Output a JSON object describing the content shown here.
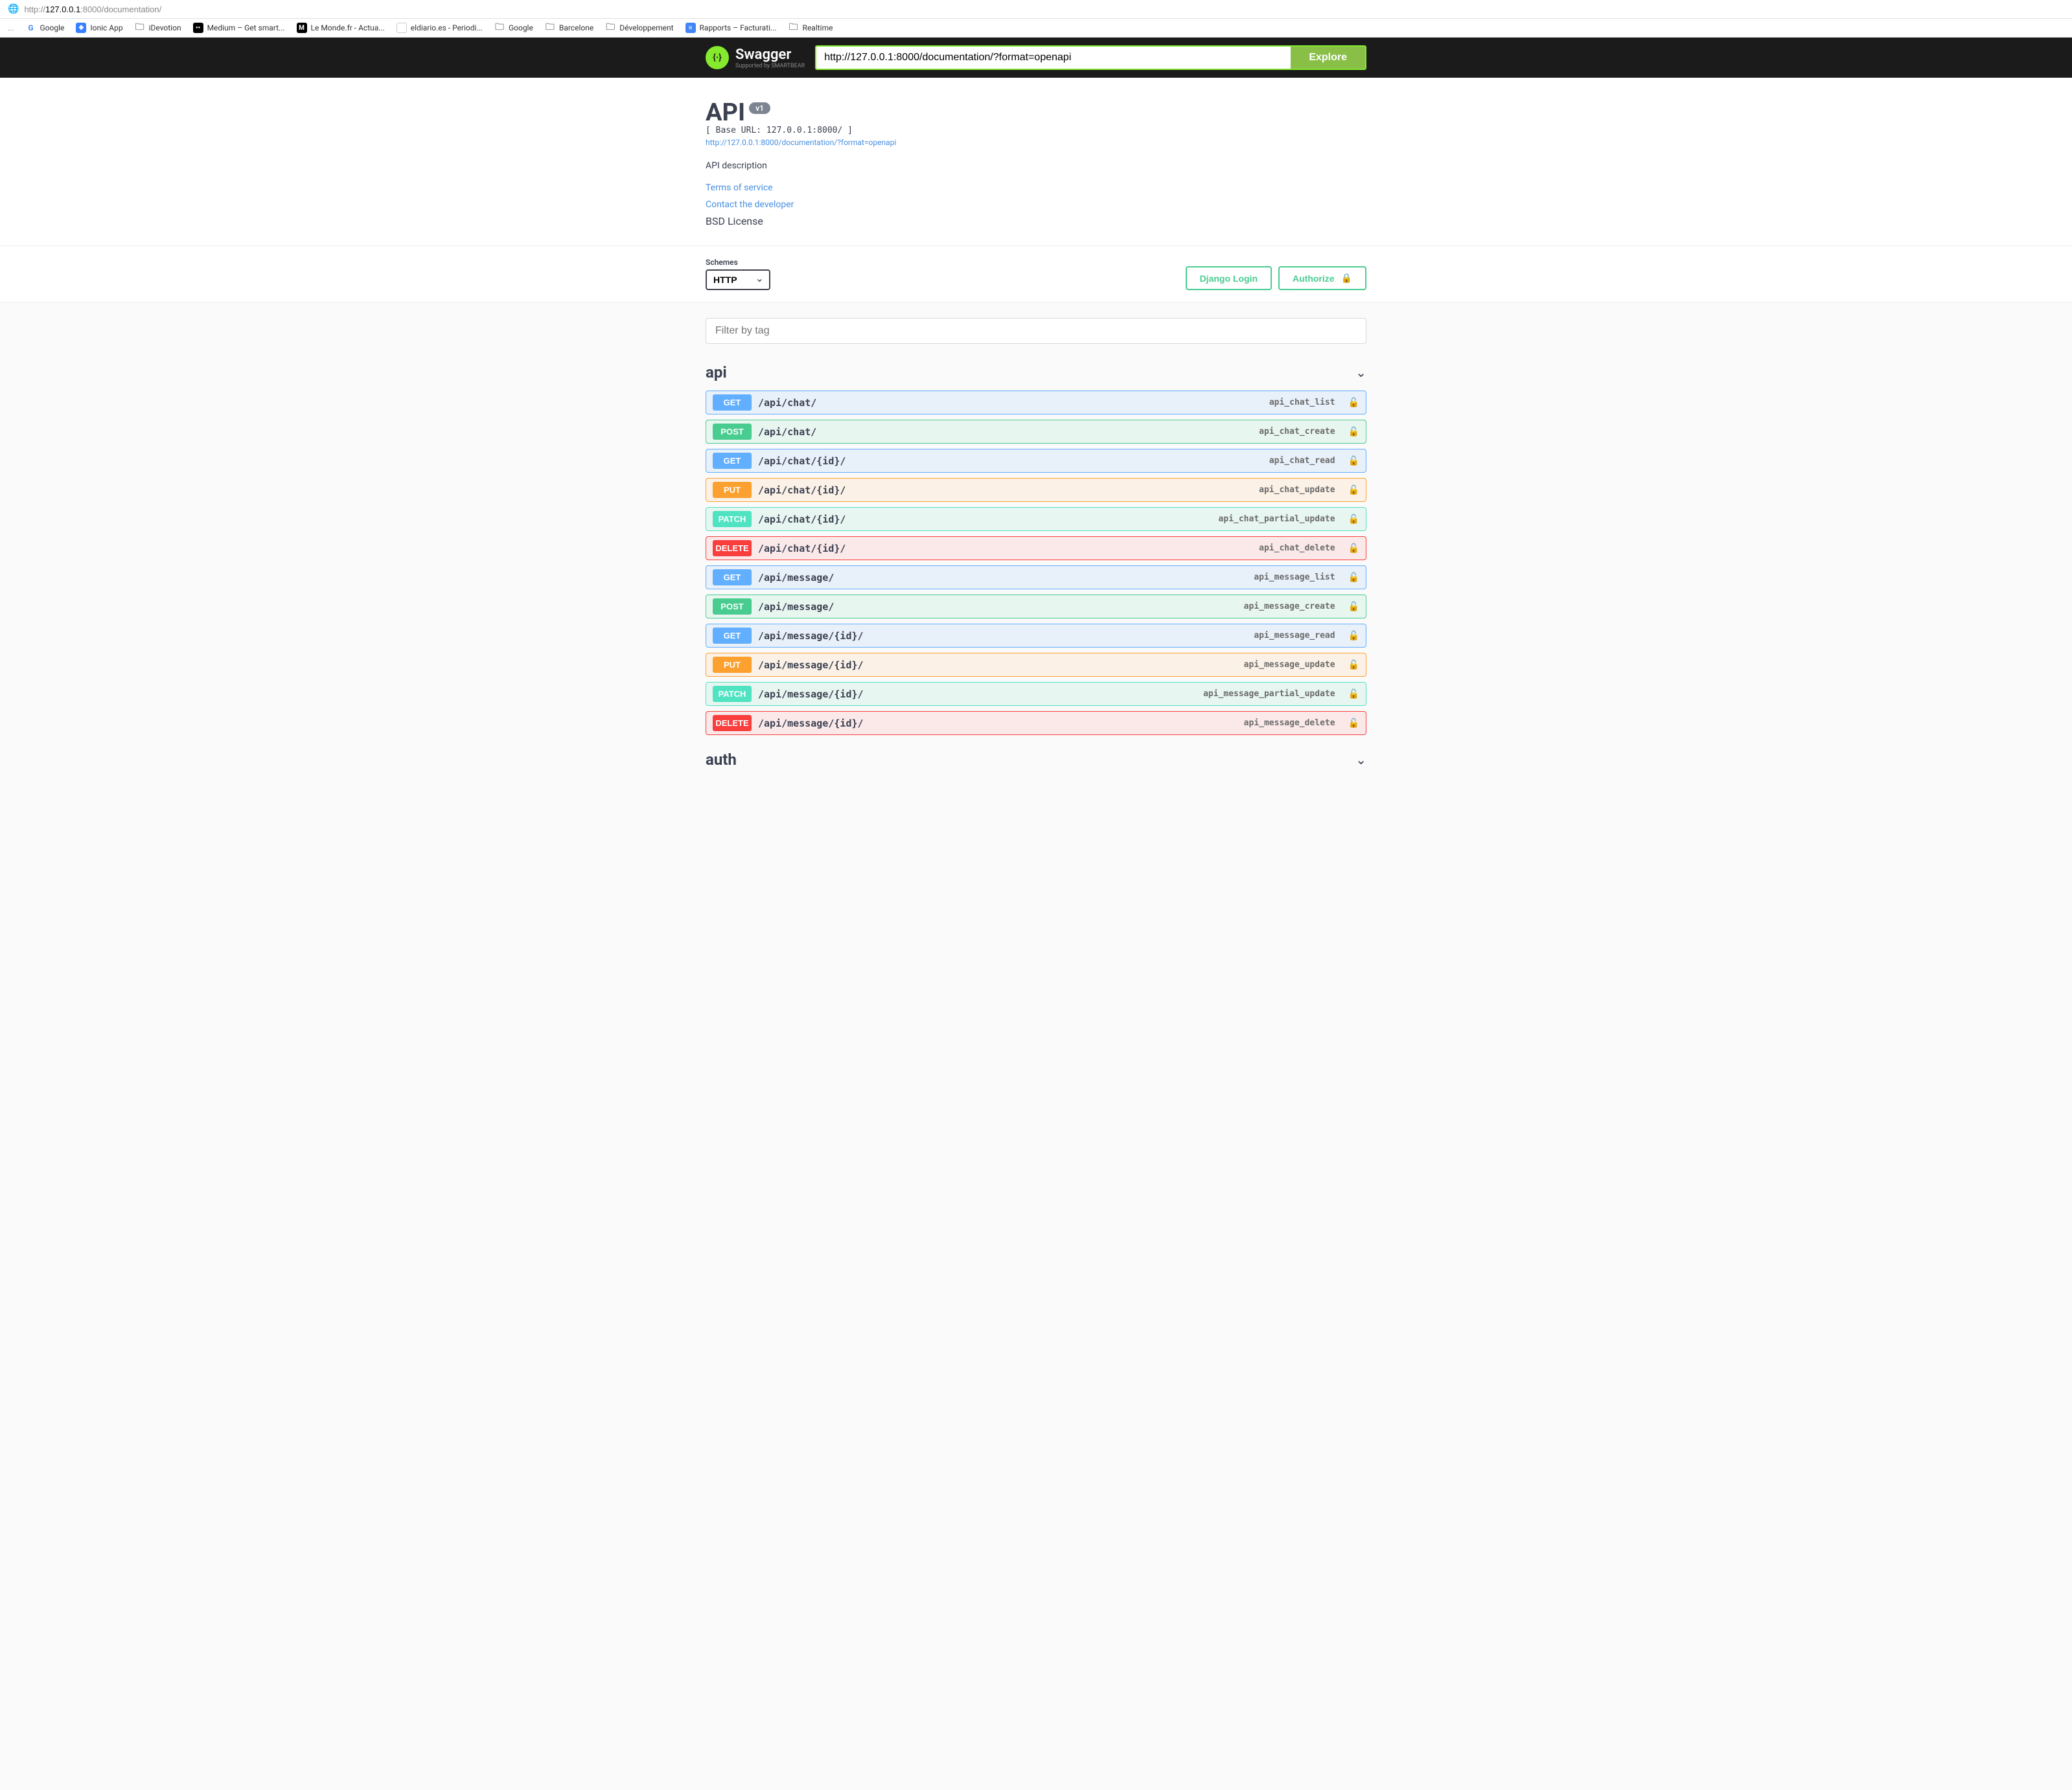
{
  "browser": {
    "protocol": "http://",
    "host": "127.0.0.1",
    "port": ":8000",
    "path": "/documentation/"
  },
  "bookmarks": [
    {
      "label": "Google",
      "iconClass": "bm-google",
      "glyph": "G"
    },
    {
      "label": "Ionic App",
      "iconClass": "bm-ionic",
      "glyph": "❖"
    },
    {
      "label": "iDevotion",
      "iconClass": "bm-folder",
      "glyph": "🗀"
    },
    {
      "label": "Medium – Get smart...",
      "iconClass": "bm-medium",
      "glyph": "••"
    },
    {
      "label": "Le Monde.fr - Actua...",
      "iconClass": "bm-lemonde",
      "glyph": "M"
    },
    {
      "label": "eldiario.es - Periodi...",
      "iconClass": "bm-eldiario",
      "glyph": "◔"
    },
    {
      "label": "Google",
      "iconClass": "bm-folder",
      "glyph": "🗀"
    },
    {
      "label": "Barcelone",
      "iconClass": "bm-folder",
      "glyph": "🗀"
    },
    {
      "label": "Développement",
      "iconClass": "bm-folder",
      "glyph": "🗀"
    },
    {
      "label": "Rapports – Facturati...",
      "iconClass": "bm-rapports",
      "glyph": "≡"
    },
    {
      "label": "Realtime",
      "iconClass": "bm-folder",
      "glyph": "🗀"
    }
  ],
  "topbar": {
    "brand": "Swagger",
    "supportedBy": "Supported by SMARTBEAR",
    "spec_url": "http://127.0.0.1:8000/documentation/?format=openapi",
    "explore_label": "Explore"
  },
  "info": {
    "title": "API",
    "version": "v1",
    "base_url": "[ Base URL: 127.0.0.1:8000/ ]",
    "spec_link": "http://127.0.0.1:8000/documentation/?format=openapi",
    "description": "API description",
    "terms": "Terms of service",
    "contact": "Contact the developer",
    "license": "BSD License"
  },
  "scheme": {
    "label": "Schemes",
    "selected": "HTTP"
  },
  "auth": {
    "login_label": "Django Login",
    "authorize_label": "Authorize"
  },
  "filter": {
    "placeholder": "Filter by tag"
  },
  "tags": [
    {
      "name": "api",
      "expanded": true,
      "ops": [
        {
          "method": "GET",
          "path": "/api/chat/",
          "desc": "api_chat_list"
        },
        {
          "method": "POST",
          "path": "/api/chat/",
          "desc": "api_chat_create"
        },
        {
          "method": "GET",
          "path": "/api/chat/{id}/",
          "desc": "api_chat_read"
        },
        {
          "method": "PUT",
          "path": "/api/chat/{id}/",
          "desc": "api_chat_update"
        },
        {
          "method": "PATCH",
          "path": "/api/chat/{id}/",
          "desc": "api_chat_partial_update"
        },
        {
          "method": "DELETE",
          "path": "/api/chat/{id}/",
          "desc": "api_chat_delete"
        },
        {
          "method": "GET",
          "path": "/api/message/",
          "desc": "api_message_list"
        },
        {
          "method": "POST",
          "path": "/api/message/",
          "desc": "api_message_create"
        },
        {
          "method": "GET",
          "path": "/api/message/{id}/",
          "desc": "api_message_read"
        },
        {
          "method": "PUT",
          "path": "/api/message/{id}/",
          "desc": "api_message_update"
        },
        {
          "method": "PATCH",
          "path": "/api/message/{id}/",
          "desc": "api_message_partial_update"
        },
        {
          "method": "DELETE",
          "path": "/api/message/{id}/",
          "desc": "api_message_delete"
        }
      ]
    },
    {
      "name": "auth",
      "expanded": false,
      "ops": []
    }
  ]
}
